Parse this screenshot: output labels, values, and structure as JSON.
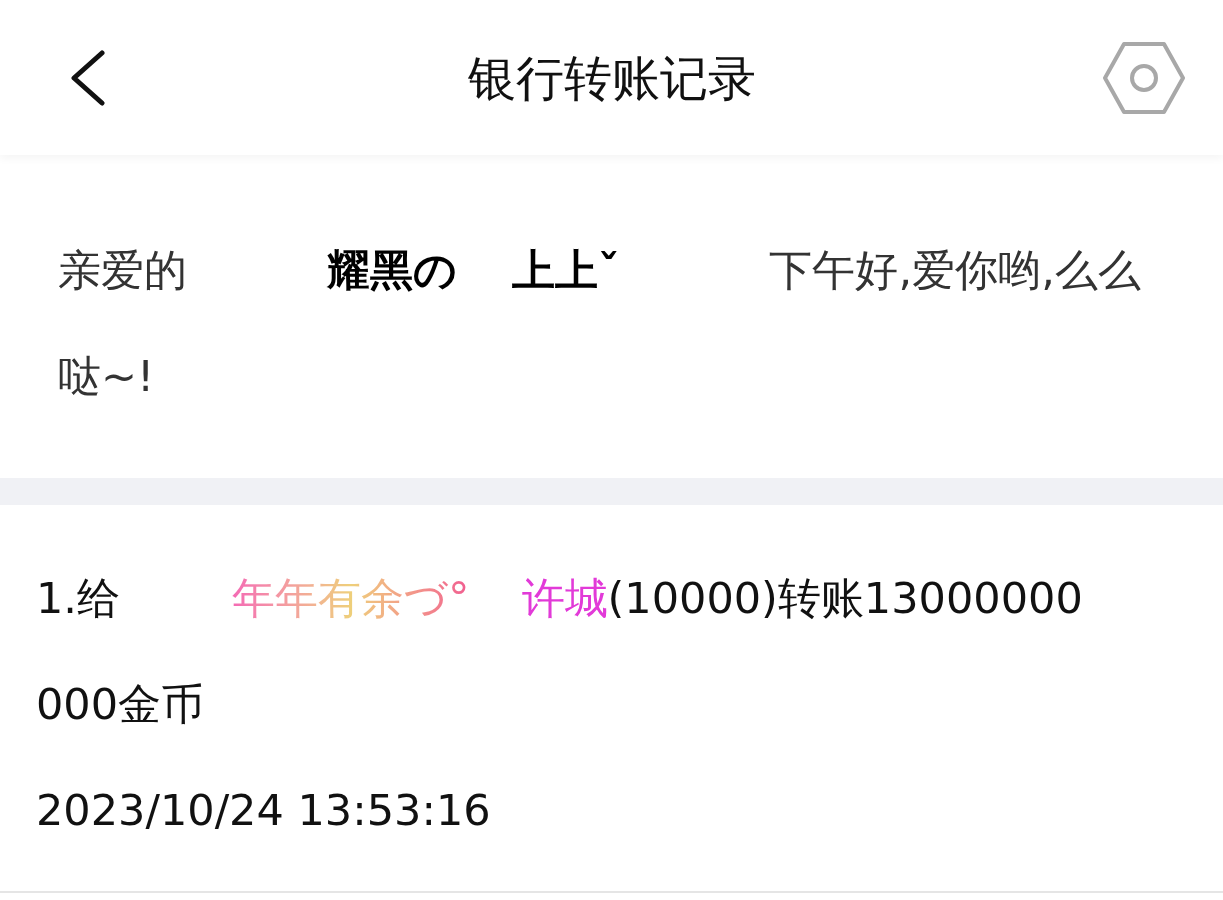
{
  "header": {
    "title": "银行转账记录"
  },
  "greeting": {
    "prefix": "亲爱的",
    "name": "耀黑の 上上ˇ",
    "message": "下午好,爱你哟,么么哒~!"
  },
  "records": [
    {
      "index": "1.给",
      "sender": "年年有余づ°",
      "recipient": "许城",
      "detail": "(10000)转账13000000000金币",
      "time": "2023/10/24 13:53:16"
    }
  ]
}
